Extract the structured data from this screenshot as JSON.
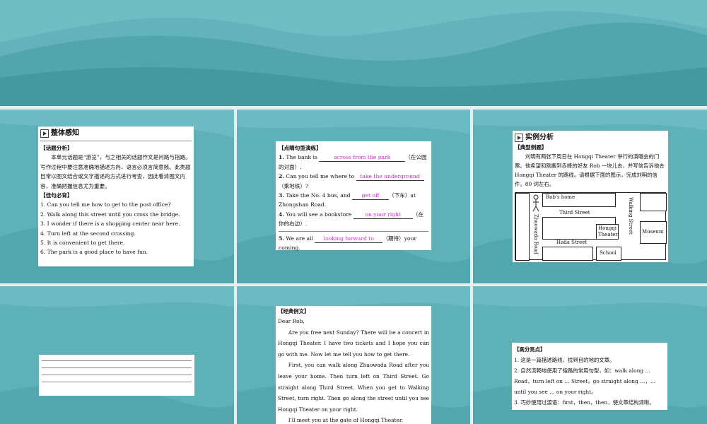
{
  "colors": {
    "teal": "#5fb1b8",
    "dark_teal": "#3d8f98",
    "blank_text": "#d028c8"
  },
  "slide1": {
    "title": "整体感知",
    "section1": "【话题分析】",
    "analysis": "本单元话题是“游览”，与之相关的话题作文是问路与指路。写作过程中要注意准确地描述方向，语言必须言简意赅。此类题目常以图文结合或文字描述的方式进行考查，因此看清图文内容，准确把握信息尤为重要。",
    "section2": "【佳句必背】",
    "sentences": [
      "1. Can you tell me how to get to the post office?",
      "2. Walk along this street until you cross the bridge.",
      "3. I wonder if there is a shopping center near here.",
      "4. Turn left at the second crossing.",
      "5. It is convenient to get there.",
      "6. The park is a good place to have fun."
    ]
  },
  "slide2": {
    "header": "【点睛句型演练】",
    "items": [
      {
        "num": "1.",
        "pre": "The bank is ",
        "ans": "across from the park",
        "post": "（在公园的对面）."
      },
      {
        "num": "2.",
        "pre": "Can you tell me where to ",
        "ans": "take the underground",
        "post": "（乘地铁）?"
      },
      {
        "num": "3.",
        "pre": "Take the No. 4 bus, and ",
        "ans": "get off",
        "post": "（下车）at Zhongshan Road."
      },
      {
        "num": "4.",
        "pre": "You will see a bookstore ",
        "ans": "on your right",
        "post": "（在你的右边）."
      },
      {
        "num": "5.",
        "pre": "We are all ",
        "ans": "looking forward to",
        "post": "（期待）your coming."
      }
    ]
  },
  "slide3": {
    "title": "实例分析",
    "header": "【典型例题】",
    "text": "刘明有两张下周日在 Hongqi Theater 举行的演唱会的门票。他希望和刚搬到赤峰的好友 Rob 一块儿去，并写信告诉他去 Hongqi Theater 的路线。请根据下面的图示，完成刘明的信件。80 词左右。",
    "map": {
      "robs_home": "Rob's home",
      "third_street": "Third Street",
      "zhaowada_road": "Zhaowada Road",
      "walking_street": "Walking Street",
      "hongqi_theater": "Hongqi Theater",
      "museum": "Museum",
      "hada_street": "Hada Street",
      "school": "School"
    }
  },
  "slide5": {
    "header": "【经典例文】",
    "lines": [
      "Dear Rob,",
      "Are you free next Sunday? There will be a concert in Hongqi Theater. I have two tickets and I hope you can go with me. Now let me tell you how to get there.",
      "First, you can walk along Zhaowada Road after you leave your home. Then turn left on Third Street. Go straight along Third Street. When you get to Walking Street, turn right. Then go along the street until you see Hongqi Theater on your right.",
      "I'll meet you at the gate of Hongqi Theater."
    ]
  },
  "slide6": {
    "header": "【高分亮点】",
    "points": [
      "1. 这是一篇描述路线、找到目的地的文章。",
      "2. 自然流畅地使用了指路的常用句型，如：walk along … Road，turn left on … Street，go straight along …，… until you see … on your right。",
      "3. 巧妙使用过渡语：first，then，then，使文章结构清晰。"
    ]
  }
}
